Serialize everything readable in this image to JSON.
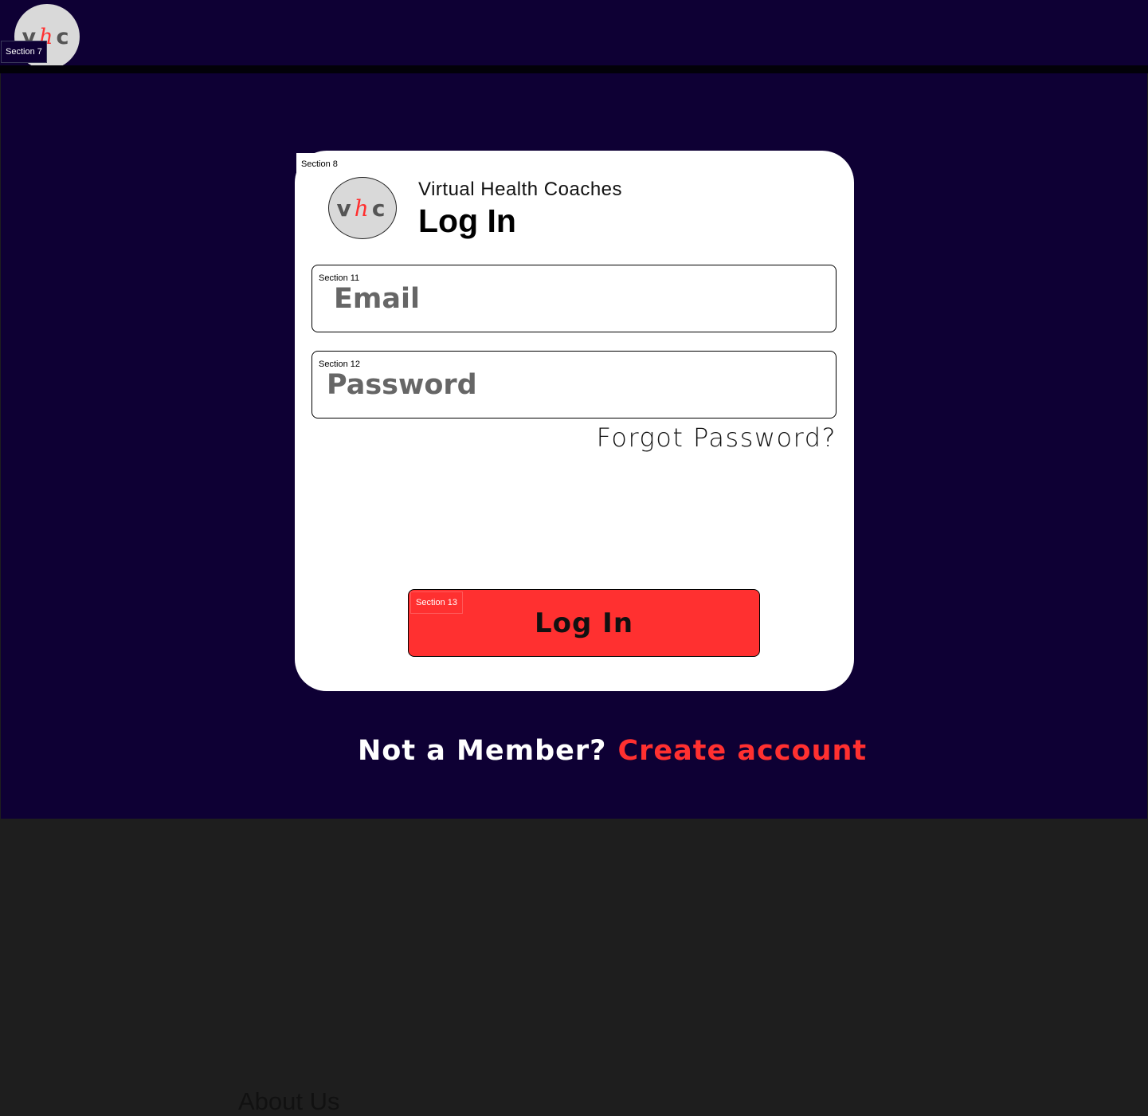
{
  "header": {
    "logo": {
      "v": "v",
      "h": "h",
      "c": "c"
    },
    "section_label": "Section 7"
  },
  "card": {
    "section_label": "Section 8",
    "logo": {
      "v": "v",
      "h": "h",
      "c": "c"
    },
    "brand": "Virtual Health Coaches",
    "title": "Log In",
    "email": {
      "section_label": "Section 11",
      "placeholder": "Email"
    },
    "password": {
      "section_label": "Section 12",
      "placeholder": "Password"
    },
    "forgot_password": "Forgot Password?",
    "login_button": {
      "section_label": "Section 13",
      "label": "Log In"
    }
  },
  "signup": {
    "question": "Not a Member?",
    "link": "Create account"
  },
  "footer": {
    "about_heading": "About Us"
  },
  "colors": {
    "navy": "#0e0034",
    "accent_red": "#ff3030",
    "dark_bg": "#1e1e1e"
  }
}
